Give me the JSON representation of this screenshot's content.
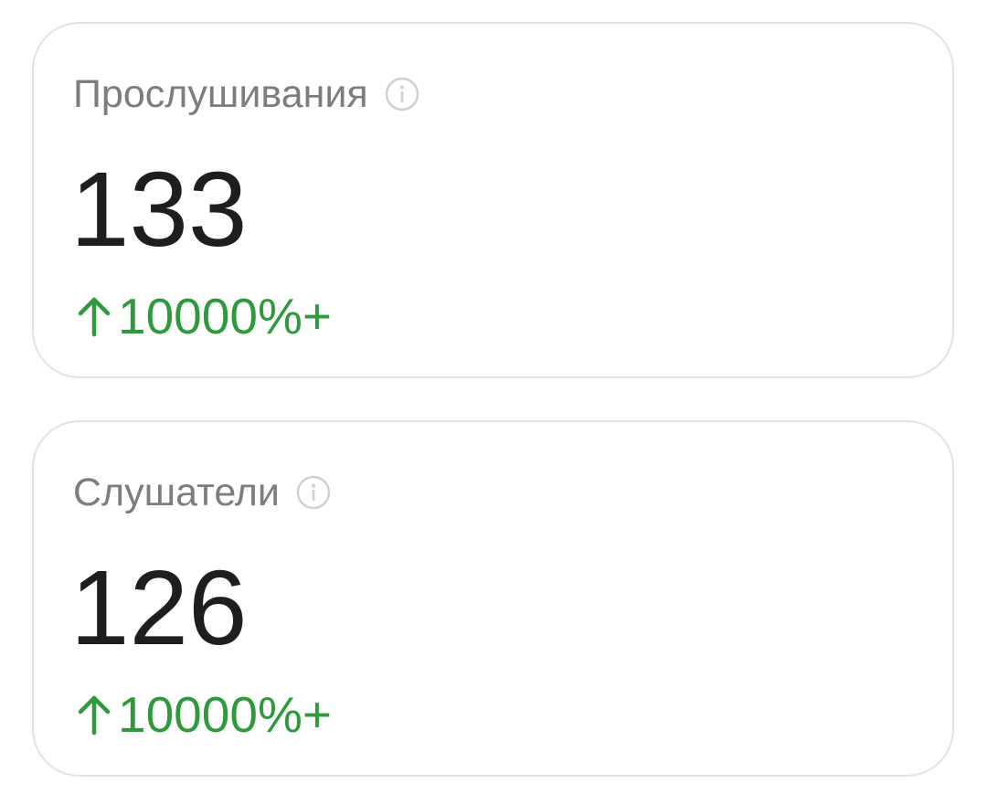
{
  "colors": {
    "card_border": "#e3e3e3",
    "title": "#7d7d7d",
    "value": "#1e1e1e",
    "positive_change": "#2e9a3c",
    "info_icon": "#cfcfcf"
  },
  "cards": [
    {
      "title": "Прослушивания",
      "value": "133",
      "change": "10000%+",
      "info_icon": "info-icon",
      "change_icon": "arrow-up-icon"
    },
    {
      "title": "Слушатели",
      "value": "126",
      "change": "10000%+",
      "info_icon": "info-icon",
      "change_icon": "arrow-up-icon"
    }
  ]
}
